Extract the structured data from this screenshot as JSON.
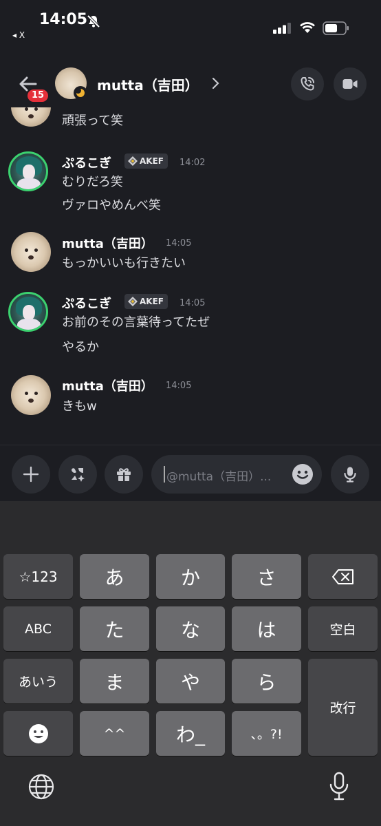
{
  "status_bar": {
    "time": "14:05",
    "back_app_label": "◂ X"
  },
  "header": {
    "unread_badge": "15",
    "contact_name": "mutta（吉田）"
  },
  "messages": [
    {
      "text": "頑張って笑"
    },
    {
      "author": "ぷるこぎ",
      "role_tag": "AKEF",
      "time": "14:02",
      "lines": [
        "むりだろ笑",
        "ヴァロやめんべ笑"
      ]
    },
    {
      "author": "mutta（吉田）",
      "time": "14:05",
      "lines": [
        "もっかいいも行きたい"
      ]
    },
    {
      "author": "ぷるこぎ",
      "role_tag": "AKEF",
      "time": "14:05",
      "lines": [
        "お前のその言葉待ってたぜ",
        "やるか"
      ]
    },
    {
      "author": "mutta（吉田）",
      "time": "14:05",
      "lines": [
        "きもw"
      ]
    }
  ],
  "composer": {
    "placeholder": "@mutta（吉田）..."
  },
  "keyboard": {
    "rows": [
      [
        "☆123",
        "あ",
        "か",
        "さ"
      ],
      [
        "ABC",
        "た",
        "な",
        "は",
        "空白"
      ],
      [
        "あいう",
        "ま",
        "や",
        "ら",
        "改行"
      ],
      [
        "^^",
        "わ_",
        "、。?!"
      ]
    ]
  },
  "icons": [
    "bell-slash-icon",
    "signal-icon",
    "wifi-icon",
    "battery-icon",
    "back-arrow-icon",
    "chevron-right-icon",
    "phone-icon",
    "video-camera-icon",
    "plus-icon",
    "apps-icon",
    "gift-icon",
    "emoji-icon",
    "microphone-icon",
    "backspace-icon",
    "globe-icon"
  ]
}
